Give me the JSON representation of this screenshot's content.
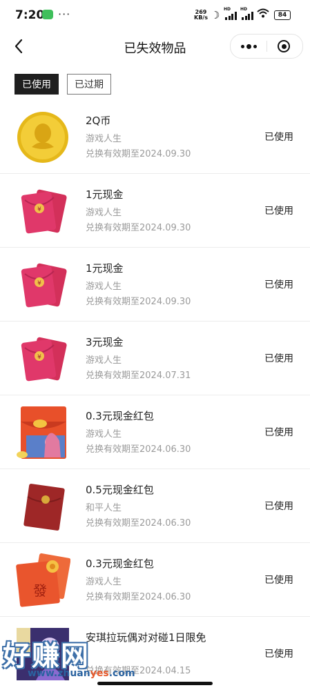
{
  "status_bar": {
    "time": "7:20",
    "dots": "···",
    "speed_value": "269",
    "speed_unit": "KB/s",
    "hd": "HD",
    "battery": "84"
  },
  "nav": {
    "title": "已失效物品"
  },
  "tabs": [
    {
      "label": "已使用",
      "active": true
    },
    {
      "label": "已过期",
      "active": false
    }
  ],
  "items": [
    {
      "name": "2Q币",
      "source": "游戏人生",
      "expiry": "兑换有效期至2024.09.30",
      "status": "已使用",
      "icon": "qq-coin-icon"
    },
    {
      "name": "1元现金",
      "source": "游戏人生",
      "expiry": "兑换有效期至2024.09.30",
      "status": "已使用",
      "icon": "red-envelope-icon"
    },
    {
      "name": "1元现金",
      "source": "游戏人生",
      "expiry": "兑换有效期至2024.09.30",
      "status": "已使用",
      "icon": "red-envelope-icon"
    },
    {
      "name": "3元现金",
      "source": "游戏人生",
      "expiry": "兑换有效期至2024.07.31",
      "status": "已使用",
      "icon": "red-envelope-icon"
    },
    {
      "name": "0.3元现金红包",
      "source": "游戏人生",
      "expiry": "兑换有效期至2024.06.30",
      "status": "已使用",
      "icon": "game-red-envelope-icon"
    },
    {
      "name": "0.5元现金红包",
      "source": "和平人生",
      "expiry": "兑换有效期至2024.06.30",
      "status": "已使用",
      "icon": "dark-red-envelope-icon"
    },
    {
      "name": "0.3元现金红包",
      "source": "游戏人生",
      "expiry": "兑换有效期至2024.06.30",
      "status": "已使用",
      "icon": "fa-red-envelope-icon"
    },
    {
      "name": "安琪拉玩偶对对碰1日限免",
      "source": "",
      "expiry": "兑换有效期至2024.04.15",
      "status": "已使用",
      "icon": "character-skin-icon"
    }
  ],
  "watermark": {
    "main": "好赚网",
    "sub_a": "www.zhuan",
    "sub_b": "yes",
    "sub_c": ".com"
  }
}
